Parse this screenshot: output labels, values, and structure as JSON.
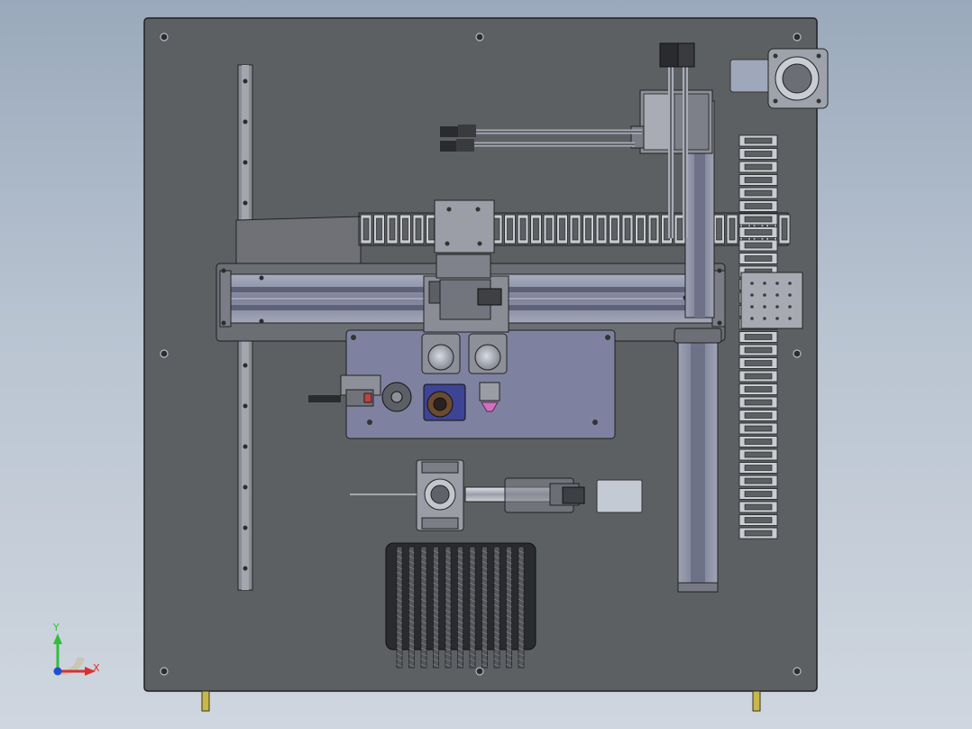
{
  "viewport": {
    "background": "#aab6c4"
  },
  "plate": {
    "color": "#5d6063",
    "edge": "#1f2022"
  },
  "triad": {
    "x_label": "X",
    "y_label": "Y",
    "x_color": "#d93030",
    "y_color": "#2fbf3a",
    "z_color": "#1f4fd1"
  },
  "colors": {
    "metal": "#8c8f96",
    "metal_light": "#b8bcc6",
    "rail": "#8a8fa6",
    "chain": "#c9ccd2",
    "dark": "#2a2b2e",
    "panel_blue": "#7e82a0",
    "pink": "#d070c0",
    "brass": "#c8b84a"
  }
}
